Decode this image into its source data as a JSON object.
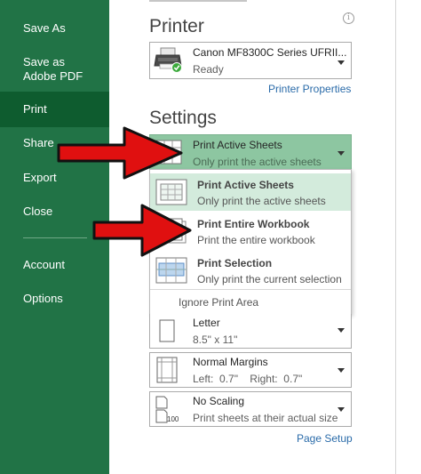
{
  "sidebar": {
    "items": [
      {
        "label": "Save As"
      },
      {
        "label": "Save as Adobe PDF"
      },
      {
        "label": "Print"
      },
      {
        "label": "Share"
      },
      {
        "label": "Export"
      },
      {
        "label": "Close"
      },
      {
        "label": "Account"
      },
      {
        "label": "Options"
      }
    ],
    "selected": "Print"
  },
  "printer": {
    "title": "Printer",
    "name": "Canon MF8300C Series UFRII...",
    "status": "Ready",
    "properties_link": "Printer Properties",
    "info_icon": "i"
  },
  "settings": {
    "title": "Settings",
    "active": {
      "title": "Print Active Sheets",
      "desc": "Only print the active sheets"
    },
    "dropdown": [
      {
        "title": "Print Active Sheets",
        "desc": "Only print the active sheets",
        "highlighted": true
      },
      {
        "title": "Print Entire Workbook",
        "desc": "Print the entire workbook"
      },
      {
        "title": "Print Selection",
        "desc": "Only print the current selection"
      }
    ],
    "ignore_print_area": "Ignore Print Area",
    "paper": {
      "title": "Letter",
      "desc": "8.5\" x 11\""
    },
    "margins": {
      "title": "Normal Margins",
      "desc": "Left:  0.7\"    Right:  0.7\""
    },
    "scaling": {
      "title": "No Scaling",
      "desc": "Print sheets at their actual size",
      "icon_text": "100"
    },
    "page_setup_link": "Page Setup"
  },
  "colors": {
    "sidebar": "#217346",
    "sidebar_selected": "#0e5c2f",
    "highlight": "#d3ebdc",
    "active_box": "#8dc6a1",
    "arrow": "#e01010",
    "link": "#2a6ba9"
  },
  "icons": [
    "printer-icon",
    "ready-check-icon",
    "info-icon",
    "active-sheets-icon",
    "entire-workbook-icon",
    "selection-icon",
    "letter-page-icon",
    "margins-icon",
    "scaling-icon",
    "dropdown-caret-icon"
  ]
}
